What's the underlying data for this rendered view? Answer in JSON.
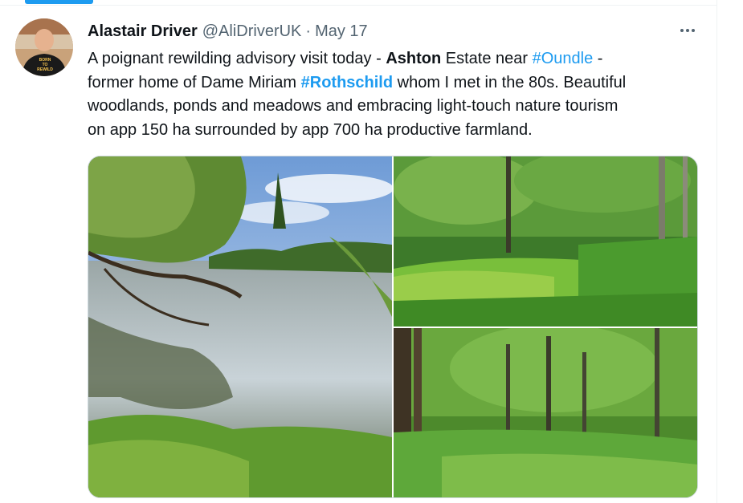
{
  "tweet": {
    "author_name": "Alastair Driver",
    "handle": "@AliDriverUK",
    "separator": "·",
    "date": "May 17",
    "lines": [
      [
        {
          "t": "A poignant rewilding advisory visit today - ",
          "s": "plain"
        },
        {
          "t": "Ashton",
          "s": "bold"
        },
        {
          "t": " Estate near ",
          "s": "plain"
        },
        {
          "t": "#Oundle",
          "s": "tag"
        },
        {
          "t": " -",
          "s": "plain"
        }
      ],
      [
        {
          "t": "former home of Dame Miriam ",
          "s": "plain"
        },
        {
          "t": "#Rothschild",
          "s": "tagbold"
        },
        {
          "t": " whom I met in the 80s. Beautiful",
          "s": "plain"
        }
      ],
      [
        {
          "t": "woodlands, ponds and meadows and embracing light-touch nature tourism",
          "s": "plain"
        }
      ],
      [
        {
          "t": "on app 150 ha surrounded by app 700 ha productive farmland.",
          "s": "plain"
        }
      ]
    ],
    "avatar_shirt_text": "BORN TO REWILD"
  },
  "media": {
    "photos": [
      {
        "name": "photo-lake-reflection",
        "subject": "lake with willow branches and sky reflection"
      },
      {
        "name": "photo-duckweed-pond",
        "subject": "green duckweed pond with reeds"
      },
      {
        "name": "photo-woodland-meadow",
        "subject": "woodland meadow with tall trees"
      }
    ]
  },
  "colors": {
    "text": "#0f1419",
    "secondary": "#536471",
    "link": "#1d9bf0",
    "border": "#cfd9de"
  },
  "icons": {
    "more": "more-horizontal-icon"
  }
}
